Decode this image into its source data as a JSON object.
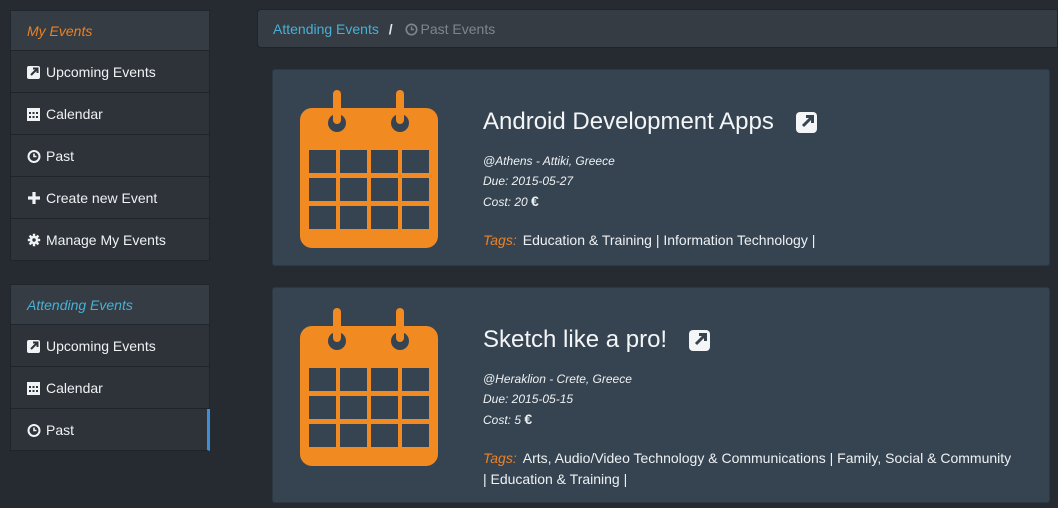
{
  "sidebar": {
    "group1_title": "My Events",
    "group1_title_color": "#ea8224",
    "group1_items": [
      {
        "label": "Upcoming Events",
        "icon": "external-link-icon"
      },
      {
        "label": "Calendar",
        "icon": "calendar-icon"
      },
      {
        "label": "Past",
        "icon": "clock-icon"
      },
      {
        "label": "Create new Event",
        "icon": "plus-icon"
      },
      {
        "label": "Manage My Events",
        "icon": "gear-icon"
      }
    ],
    "group2_title": "Attending Events",
    "group2_title_color": "#48b0d6",
    "group2_items": [
      {
        "label": "Upcoming Events",
        "icon": "external-link-icon"
      },
      {
        "label": "Calendar",
        "icon": "calendar-icon"
      },
      {
        "label": "Past",
        "icon": "clock-icon",
        "active": true
      }
    ]
  },
  "breadcrumb": {
    "parent": "Attending Events",
    "separator": "/",
    "current": "Past Events"
  },
  "events": [
    {
      "title": "Android Development Apps",
      "location": "@Athens - Attiki, Greece",
      "due": "Due: 2015-05-27",
      "cost": "Cost: 20",
      "currency": "€",
      "tags_label": "Tags:",
      "tags": "Education & Training | Information Technology |"
    },
    {
      "title": "Sketch like a pro!",
      "location": "@Heraklion - Crete, Greece",
      "due": "Due: 2015-05-15",
      "cost": "Cost: 5",
      "currency": "€",
      "tags_label": "Tags:",
      "tags": "Arts, Audio/Video Technology & Communications | Family, Social & Community | Education & Training |"
    }
  ],
  "colors": {
    "accent_orange": "#ea8224",
    "link_blue": "#48b0d6",
    "active_border": "#3d8fd9"
  }
}
